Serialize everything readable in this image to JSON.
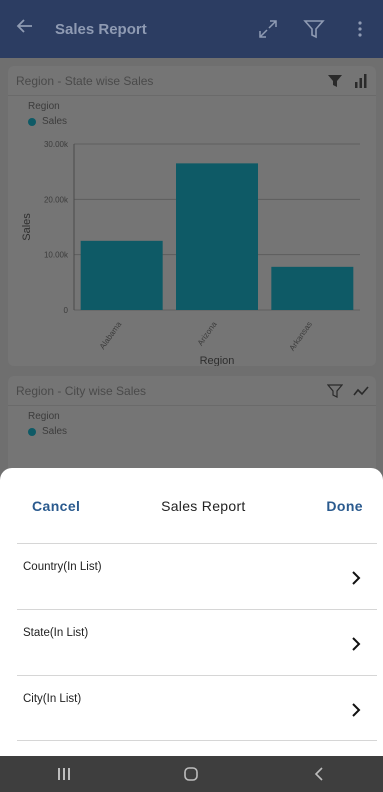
{
  "app": {
    "title": "Sales Report"
  },
  "cards": [
    {
      "title": "Region - State wise Sales",
      "legend_title": "Region",
      "legend_series": "Sales"
    },
    {
      "title": "Region - City wise Sales",
      "legend_title": "Region",
      "legend_series": "Sales"
    }
  ],
  "chart_data": {
    "type": "bar",
    "categories": [
      "Alabama",
      "Arizona",
      "Arkansas"
    ],
    "series": [
      {
        "name": "Sales",
        "values": [
          12500,
          26500,
          7800
        ]
      }
    ],
    "xlabel": "Region",
    "ylabel": "Sales",
    "ylim": [
      0,
      30000
    ],
    "yticks": [
      "0",
      "10.00k",
      "20.00k",
      "30.00k"
    ],
    "grid": true,
    "color": "#0e5a66"
  },
  "sheet": {
    "cancel_label": "Cancel",
    "title": "Sales Report",
    "done_label": "Done",
    "rows": [
      {
        "label": "Country(In List)"
      },
      {
        "label": "State(In List)"
      },
      {
        "label": "City(In List)"
      }
    ]
  },
  "colors": {
    "appbar": "#2c3d62",
    "accent": "#2a5a8e",
    "bar": "#0e5a66"
  }
}
